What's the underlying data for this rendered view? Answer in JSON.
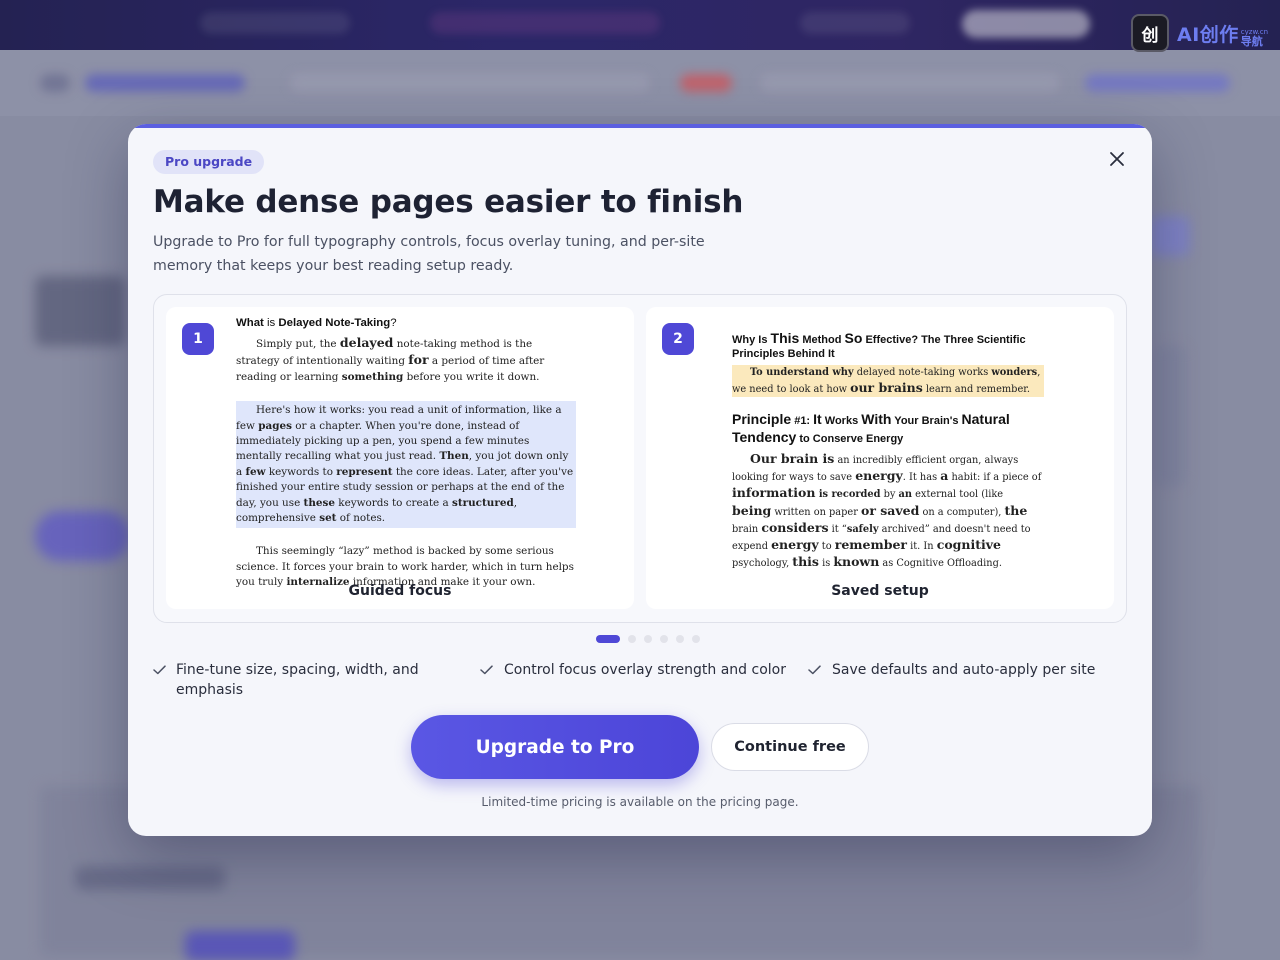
{
  "modal": {
    "badge": "Pro upgrade",
    "title": "Make dense pages easier to finish",
    "description": "Upgrade to Pro for full typography controls, focus overlay tuning, and per-site memory that keeps your best reading setup ready.",
    "close_icon": "close-icon"
  },
  "slides": [
    {
      "step": "1",
      "caption": "Guided focus",
      "doc": {
        "heading": {
          "a": "What",
          "b": " is ",
          "c": "Delayed Note-Taking",
          "d": "?"
        },
        "p1": {
          "a": "Simply put, the ",
          "b": "delayed",
          "c": " note-taking method is the strategy of intentionally waiting ",
          "d": "for",
          "e": " a period of time after reading or learning ",
          "f": "something",
          "g": " before you write it down."
        },
        "p2": {
          "a": "Here's how it works: you read a unit of information, like a few ",
          "b": "pages",
          "c": " or a chapter. When you're done, instead of immediately picking up a pen, you spend a few minutes mentally recalling what you just read. ",
          "d": "Then",
          "e": ", you jot down only a ",
          "f": "few",
          "g": " keywords to ",
          "h": "represent",
          "i": " the core ideas. Later, after you've finished your entire study session or perhaps at the end of the day, you use ",
          "j": "these",
          "k": " keywords to create a ",
          "l": "structured",
          "m": ", comprehensive ",
          "n": "set",
          "o": " of notes."
        },
        "p3": {
          "a": "This seemingly “lazy” method is backed by some serious science. It forces your brain to work harder, which in turn helps you truly ",
          "b": "internalize",
          "c": " information and make it your own."
        }
      }
    },
    {
      "step": "2",
      "caption": "Saved setup",
      "doc": {
        "heading": {
          "a": "Why Is ",
          "b": "This",
          "c": " Method ",
          "d": "So",
          "e": " Effective? The Three Scientific Principles Behind ",
          "f": "It"
        },
        "p1": {
          "a": "To understand why",
          "b": " delayed note-taking works ",
          "c": "wonders",
          "d": ", we need to look at how ",
          "e": "our brains",
          "f": " learn and remember."
        },
        "heading2": {
          "a": "Principle",
          "b": " #1: ",
          "c": "It",
          "d": " Works ",
          "e": "With",
          "f": " Your Brain's ",
          "g": "Natural Tendency",
          "h": " to Conserve Energy"
        },
        "p2": {
          "a": "Our brain is",
          "b": " an incredibly efficient organ, always looking for ways to save ",
          "c": "energy",
          "d": ". It has ",
          "e": "a",
          "f": " habit: if a piece of ",
          "g": "information",
          "h": " is recorded",
          "i": " by ",
          "j": "an",
          "k": " external tool (like ",
          "l": "being",
          "m": " written on paper ",
          "n": "or saved",
          "o": " on a computer), ",
          "p": "the",
          "q": " brain ",
          "r": "considers",
          "s": " it “",
          "t": "safely",
          "u": " archived” and doesn't need to expend ",
          "v": "energy",
          "w": " to ",
          "x": "remember",
          "y": " it. In ",
          "z": "cognitive",
          "z1": " psychology, ",
          "z2": "this",
          "z3": " is ",
          "z4": "known",
          "z5": " as Cognitive Offloading."
        }
      }
    }
  ],
  "carousel": {
    "page_count": 6,
    "active_index": 0
  },
  "features": [
    "Fine-tune size, spacing, width, and emphasis",
    "Control focus overlay strength and color",
    "Save defaults and auto-apply per site"
  ],
  "buttons": {
    "primary": "Upgrade to Pro",
    "secondary": "Continue free"
  },
  "pricing_note": "Limited-time pricing is available on the pricing page.",
  "logo": {
    "mark": "创",
    "main": "AI创作",
    "domain": "cyzw.cn",
    "nav": "导航"
  },
  "colors": {
    "accent": "#4f48d6",
    "badge_bg": "#e1e3f8",
    "highlight_blue": "#dfe6fb",
    "highlight_yellow": "#fbe9bd"
  }
}
